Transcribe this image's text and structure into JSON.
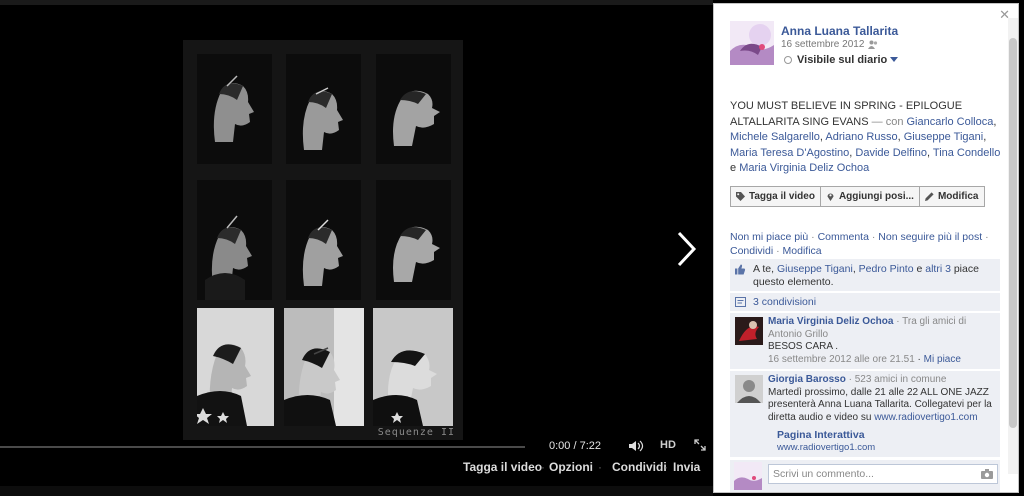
{
  "video": {
    "caption": "Sequenze II",
    "time_display": "0:00 / 7:22",
    "progress": 0,
    "quality_label": "HD",
    "actions": [
      "Tagga il video",
      "Opzioni",
      "Condividi",
      "Invia"
    ]
  },
  "panel": {
    "owner_name": "Anna Luana Tallarita",
    "post_date": "16 settembre 2012",
    "visibility_label": "Visibile sul diario",
    "description": {
      "text": "YOU MUST BELIEVE IN SPRING - EPILOGUE ALTALLARITA SING EVANS",
      "with_prefix": "— con",
      "conjunction": "e",
      "tagged": [
        "Giancarlo Colloca",
        "Michele Salgarello",
        "Adriano Russo",
        "Giuseppe Tigani",
        "Maria Teresa D'Agostino",
        "Davide Delfino",
        "Tina Condello",
        "Maria Virginia Deliz Ochoa"
      ]
    },
    "buttons": {
      "tag": "Tagga il video",
      "location": "Aggiungi posi...",
      "edit": "Modifica"
    },
    "actions": [
      "Non mi piace più",
      "Commenta",
      "Non seguire più il post",
      "Condividi",
      "Modifica"
    ],
    "likes": {
      "prefix": "A te,",
      "names": [
        "Giuseppe Tigani",
        "Pedro Pinto"
      ],
      "and": "e",
      "others": "altri 3",
      "suffix": "piace questo elemento."
    },
    "shares_label": "3 condivisioni",
    "comments": [
      {
        "name": "Maria Virginia Deliz Ochoa",
        "meta": "· Tra gli amici di Antonio Grillo",
        "text": "BESOS CARA .",
        "time": "16 settembre 2012 alle ore 21.51",
        "like_label": "Mi piace"
      },
      {
        "name": "Giorgia Barosso",
        "meta": "· 523 amici in comune",
        "text": "Martedì prossimo, dalle 21 alle 22 ALL ONE JAZZ presenterà Anna Luana Tallarita. Collegatevi per la diretta audio e video su",
        "link": "www.radiovertigo1.com",
        "attachment_title": "Pagina Interattiva",
        "attachment_url": "www.radiovertigo1.com"
      }
    ],
    "composer_placeholder": "Scrivi un commento..."
  },
  "colors": {
    "link": "#3b5998",
    "panel_box": "#edeff4",
    "stage_background": "#000000"
  },
  "icons": [
    "next-arrow-icon",
    "volume-icon",
    "fullscreen-icon",
    "close-icon",
    "audience-icon",
    "tag-icon",
    "location-pin-icon",
    "pencil-icon",
    "thumbs-up-icon",
    "share-icon",
    "camera-icon"
  ]
}
